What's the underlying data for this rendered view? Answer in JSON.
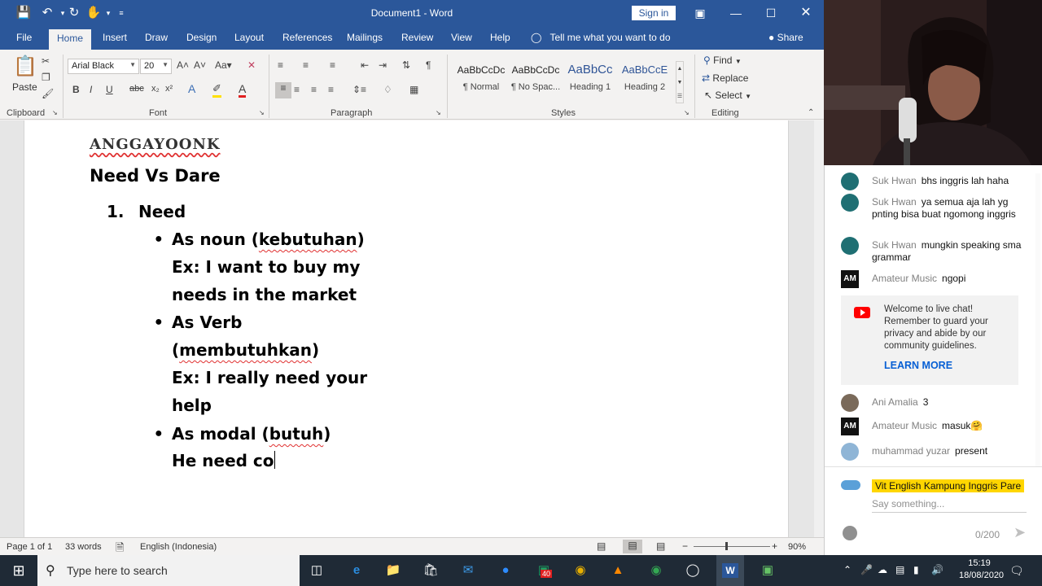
{
  "word": {
    "doc_title": "Document1  -  Word",
    "signin_label": "Sign in",
    "tabs": [
      "File",
      "Home",
      "Insert",
      "Draw",
      "Design",
      "Layout",
      "References",
      "Mailings",
      "Review",
      "View",
      "Help"
    ],
    "tell_me": "Tell me what you want to do",
    "share_label": "Share",
    "ribbon": {
      "paste_label": "Paste",
      "clipboard_label": "Clipboard",
      "font_label": "Font",
      "paragraph_label": "Paragraph",
      "styles_label": "Styles",
      "editing_label": "Editing",
      "font_name": "Arial Black",
      "font_size": "20",
      "styles": [
        {
          "sample": "AaBbCcDc",
          "name": "¶ Normal"
        },
        {
          "sample": "AaBbCcDc",
          "name": "¶ No Spac..."
        },
        {
          "sample": "AaBbCc",
          "name": "Heading 1"
        },
        {
          "sample": "AaBbCcE",
          "name": "Heading 2"
        }
      ],
      "find_label": "Find",
      "replace_label": "Replace",
      "select_label": "Select"
    },
    "document": {
      "brand": "ANGGAYOONK",
      "heading": "Need Vs Dare",
      "list_number": "1.",
      "list_title": "Need",
      "bullet1_prefix": "As noun (",
      "bullet1_word": "kebutuhan",
      "bullet1_suffix": ")",
      "bullet1_ex_line1": "Ex: I want to buy my",
      "bullet1_ex_line2": "needs in the market",
      "bullet2_line1": "As Verb",
      "bullet2_open": "(",
      "bullet2_word": "membutuhkan",
      "bullet2_close": ")",
      "bullet2_ex_line1": "Ex: I really need your",
      "bullet2_ex_line2": "help",
      "bullet3_prefix": "As modal (",
      "bullet3_word": "butuh",
      "bullet3_suffix": ")",
      "typing_line": "He need co"
    },
    "status": {
      "page": "Page 1 of 1",
      "words": "33 words",
      "language": "English (Indonesia)",
      "zoom": "90%"
    }
  },
  "chat": {
    "messages": [
      {
        "author": "Suk Hwan",
        "text": "bhs inggris lah haha",
        "avatar_color": "#1f6f73"
      },
      {
        "author": "Suk Hwan",
        "text": "ya semua aja lah yg pnting bisa buat ngomong inggris",
        "avatar_color": "#1f6f73"
      },
      {
        "author": "Suk Hwan",
        "text": "mungkin speaking sma grammar",
        "avatar_color": "#1f6f73"
      },
      {
        "author": "Amateur Music",
        "text": "ngopi",
        "avatar_color": "#111111"
      }
    ],
    "welcome_text": "Welcome to live chat! Remember to guard your privacy and abide by our community guidelines.",
    "learn_more": "LEARN MORE",
    "later_messages": [
      {
        "author": "Ani Amalia",
        "text": "3",
        "avatar_color": "#7a6a5a"
      },
      {
        "author": "Amateur Music",
        "text": "masuk🤗",
        "avatar_color": "#111111"
      },
      {
        "author": "muhammad yuzar",
        "text": "present",
        "avatar_color": "#8fb5d6"
      }
    ],
    "channel_name": "Vit English Kampung Inggris Pare",
    "input_placeholder": "Say something...",
    "char_count": "0/200"
  },
  "taskbar": {
    "search_placeholder": "Type here to search",
    "mail_badge": "40",
    "time": "15:19",
    "date": "18/08/2020"
  },
  "colors": {
    "word_blue": "#2b579a",
    "spell_red": "#e03131",
    "link_blue": "#065fd4",
    "taskbar": "#1f2a36"
  }
}
